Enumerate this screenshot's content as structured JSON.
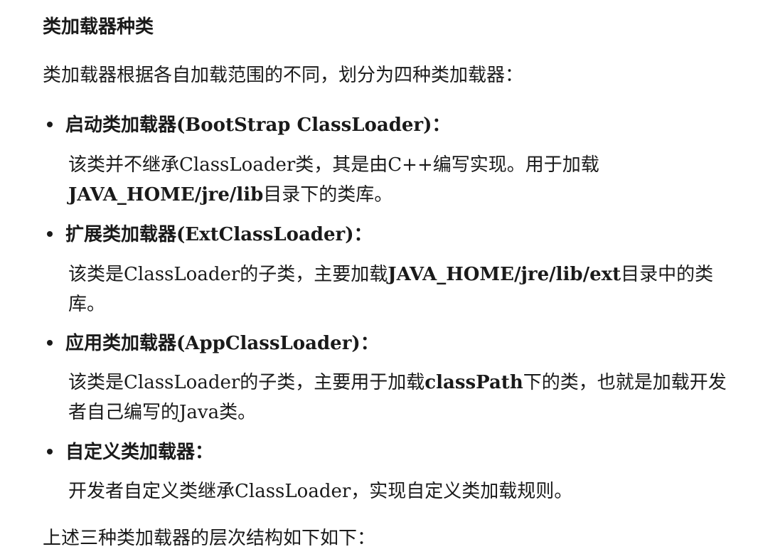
{
  "heading": "类加载器种类",
  "intro": "类加载器根据各自加载范围的不同，划分为四种类加载器：",
  "items": [
    {
      "title": "启动类加载器(BootStrap ClassLoader)：",
      "desc_line1": "该类并不继承ClassLoader类，其是由C++编写实现。用于加载",
      "desc_line2_bold": "JAVA_HOME/jre/lib",
      "desc_line2_rest": "目录下的类库。"
    },
    {
      "title": "扩展类加载器(ExtClassLoader)：",
      "desc_line1_pre": "该类是ClassLoader的子类，主要加载",
      "desc_line1_bold": "JAVA_HOME/jre/lib/ext",
      "desc_line1_post": "目录中的类",
      "desc_line2": "库。"
    },
    {
      "title": "应用类加载器(AppClassLoader)：",
      "desc_line1_pre": "该类是ClassLoader的子类，主要用于加载",
      "desc_line1_bold": "classPath",
      "desc_line1_post": "下的类，也就是加载开发",
      "desc_line2": "者自己编写的Java类。"
    },
    {
      "title": "自定义类加载器：",
      "desc_line1": "开发者自定义类继承ClassLoader，实现自定义类加载规则。"
    }
  ],
  "outro": "上述三种类加载器的层次结构如下如下："
}
